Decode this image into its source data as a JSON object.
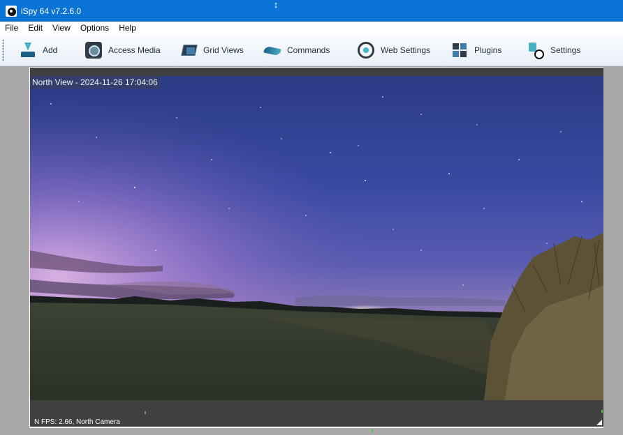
{
  "window": {
    "title": "iSpy 64 v7.2.6.0",
    "titlebar_color": "#0a74d6",
    "cursor_glyph": "↕"
  },
  "menu": {
    "items": [
      "File",
      "Edit",
      "View",
      "Options",
      "Help"
    ]
  },
  "toolbar": {
    "buttons": [
      {
        "label": "Add",
        "icon": "add-camera-icon"
      },
      {
        "label": "Access Media",
        "icon": "access-media-icon"
      },
      {
        "label": "Grid Views",
        "icon": "grid-views-icon"
      },
      {
        "label": "Commands",
        "icon": "commands-icon"
      },
      {
        "label": "Web Settings",
        "icon": "web-settings-icon"
      },
      {
        "label": "Plugins",
        "icon": "plugins-icon"
      },
      {
        "label": "Settings",
        "icon": "settings-icon"
      }
    ]
  },
  "camera": {
    "caption": "North View - 2024-11-26 17:04:06",
    "status": "N  FPS: 2.66, North Camera",
    "panel_color": "#404040"
  }
}
